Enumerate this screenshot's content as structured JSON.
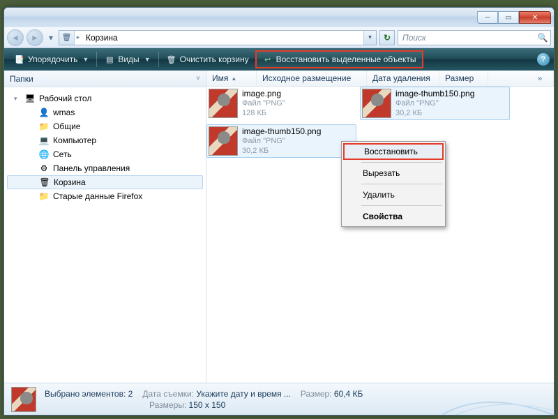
{
  "window": {
    "title": ""
  },
  "address": {
    "crumb": "Корзина"
  },
  "search": {
    "placeholder": "Поиск"
  },
  "toolbar": {
    "organize": "Упорядочить",
    "views": "Виды",
    "empty": "Очистить корзину",
    "restore_selected": "Восстановить выделенные объекты"
  },
  "sidebar": {
    "header": "Папки",
    "items": [
      {
        "label": "Рабочий стол",
        "depth": 0,
        "type": "desktop",
        "expanded": true
      },
      {
        "label": "wmas",
        "depth": 1,
        "type": "user"
      },
      {
        "label": "Общие",
        "depth": 1,
        "type": "public"
      },
      {
        "label": "Компьютер",
        "depth": 1,
        "type": "computer"
      },
      {
        "label": "Сеть",
        "depth": 1,
        "type": "network"
      },
      {
        "label": "Панель управления",
        "depth": 1,
        "type": "cpanel"
      },
      {
        "label": "Корзина",
        "depth": 1,
        "type": "recycle",
        "selected": true
      },
      {
        "label": "Старые данные Firefox",
        "depth": 1,
        "type": "folder"
      }
    ]
  },
  "columns": {
    "name": "Имя",
    "origpath": "Исходное размещение",
    "deldate": "Дата удаления",
    "size": "Размер"
  },
  "files": [
    {
      "name": "image.png",
      "type": "Файл \"PNG\"",
      "size": "128 КБ",
      "selected": false
    },
    {
      "name": "image-thumb150.png",
      "type": "Файл \"PNG\"",
      "size": "30,2 КБ",
      "selected": true
    },
    {
      "name": "image-thumb150.png",
      "type": "Файл \"PNG\"",
      "size": "30,2 КБ",
      "selected": true
    }
  ],
  "context_menu": {
    "restore": "Восстановить",
    "cut": "Вырезать",
    "delete": "Удалить",
    "properties": "Свойства"
  },
  "status": {
    "selected_label": "Выбрано элементов:",
    "selected_count": "2",
    "date_label": "Дата съемки:",
    "date_value": "Укажите дату и время ...",
    "dims_label": "Размеры:",
    "dims_value": "150 x 150",
    "size_label": "Размер:",
    "size_value": "60,4 КБ"
  }
}
